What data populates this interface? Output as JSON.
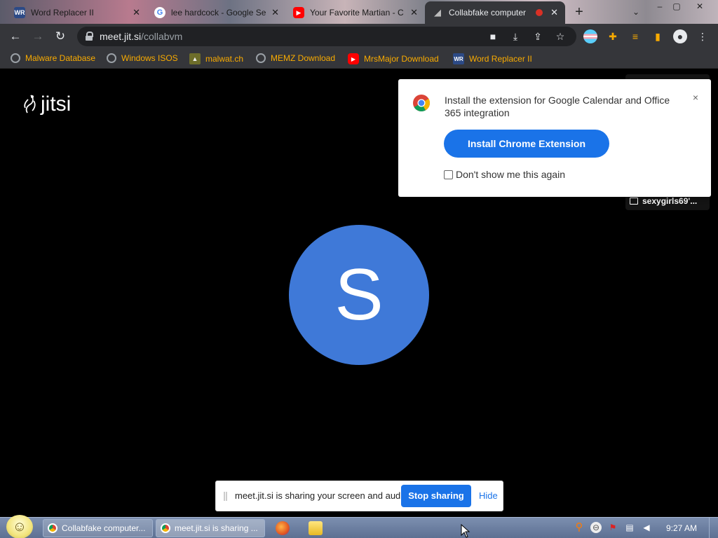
{
  "tabs": [
    {
      "title": "Word Replacer II",
      "icon": "word-replacer-icon",
      "close": "✕"
    },
    {
      "title": "lee hardcock - Google Se",
      "icon": "google-icon",
      "close": "✕"
    },
    {
      "title": "Your Favorite Martian - C",
      "icon": "youtube-icon",
      "close": "✕"
    },
    {
      "title": "Collabfake computer",
      "icon": "collabfake-icon",
      "close": "✕",
      "active": true
    }
  ],
  "new_tab": "+",
  "omnibox": {
    "domain": "meet.jit.si",
    "path": "/collabvm"
  },
  "bookmarks": [
    {
      "label": "Malware Database",
      "icon": "globe-icon"
    },
    {
      "label": "Windows ISOS",
      "icon": "globe-icon"
    },
    {
      "label": "malwat.ch",
      "icon": "malwatch-icon"
    },
    {
      "label": "MEMZ Download",
      "icon": "globe-icon"
    },
    {
      "label": "MrsMajor Download",
      "icon": "youtube-icon"
    },
    {
      "label": "Word Replacer II",
      "icon": "word-replacer-icon"
    }
  ],
  "page": {
    "logo": "jitsi",
    "avatar_letter": "S",
    "thumbnail_name": "sexygirls69'..."
  },
  "extension_popup": {
    "message": "Install the extension for Google Calendar and Office 365 integration",
    "install_label": "Install Chrome Extension",
    "dont_show_label": "Don't show me this again",
    "close": "×"
  },
  "share_bar": {
    "message": "meet.jit.si is sharing your screen and audio.",
    "stop_label": "Stop sharing",
    "hide_label": "Hide"
  },
  "taskbar": {
    "buttons": [
      {
        "label": "Collabfake computer..."
      },
      {
        "label": "meet.jit.si is sharing ..."
      }
    ],
    "clock": "9:27 AM"
  }
}
